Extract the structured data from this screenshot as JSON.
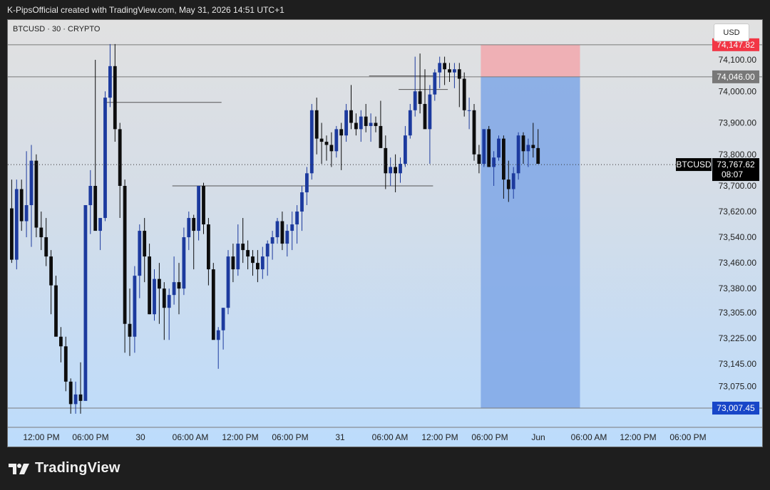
{
  "header": {
    "credit": "K-PipsOfficial created with TradingView.com, May 31, 2026 14:51 UTC+1"
  },
  "symbol_info": "BTCUSD · 30 · CRYPTO",
  "currency_button": "USD",
  "brand": "TradingView",
  "colors": {
    "bull": "#1c3a9e",
    "bear": "#0d0d0d",
    "stop_zone": "#f2a7ad",
    "target_zone": "#7fa7e6",
    "last_price": "#000000",
    "target_label": "#1846c8",
    "stop_label": "#f23645",
    "level_label": "#787878"
  },
  "chart_data": {
    "type": "candlestick",
    "symbol": "BTCUSD",
    "interval": "30",
    "y_ticks": [
      "74,100.00",
      "74,000.00",
      "73,900.00",
      "73,800.00",
      "73,700.00",
      "73,620.00",
      "73,540.00",
      "73,460.00",
      "73,380.00",
      "73,305.00",
      "73,225.00",
      "73,145.00",
      "73,075.00"
    ],
    "x_ticks": [
      "12:00 PM",
      "06:00 PM",
      "30",
      "06:00 AM",
      "12:00 PM",
      "06:00 PM",
      "31",
      "06:00 AM",
      "12:00 PM",
      "06:00 PM",
      "Jun",
      "06:00 AM",
      "12:00 PM",
      "06:00 PM"
    ],
    "price_labels": [
      {
        "name": "stop",
        "text": "74,147.82"
      },
      {
        "name": "entry",
        "text": "74,046.00"
      },
      {
        "name": "target",
        "text": "73,007.45"
      }
    ],
    "last_price": {
      "symbol": "BTCUSD",
      "value": "73,767.62",
      "countdown": "08:07"
    },
    "levels": [
      74147.82,
      74046.0,
      73007.45
    ],
    "annotation_lines": [
      {
        "from_bar": 19,
        "to_bar": 43,
        "price": 73965
      },
      {
        "from_bar": 33,
        "to_bar": 86,
        "price": 73700
      },
      {
        "from_bar": 73,
        "to_bar": 86,
        "price": 74049
      },
      {
        "from_bar": 79,
        "to_bar": 89,
        "price": 74006
      }
    ],
    "position_zone": {
      "from_bar": 96,
      "to_bar": 115,
      "stop": 74147.82,
      "entry": 74046.0,
      "target": 73007.45
    },
    "ohlc": [
      [
        73630,
        73720,
        73460,
        73470
      ],
      [
        73470,
        73720,
        73440,
        73690
      ],
      [
        73690,
        73720,
        73560,
        73590
      ],
      [
        73590,
        73810,
        73540,
        73640
      ],
      [
        73640,
        73830,
        73510,
        73780
      ],
      [
        73780,
        73800,
        73540,
        73570
      ],
      [
        73570,
        73620,
        73500,
        73540
      ],
      [
        73540,
        73600,
        73450,
        73480
      ],
      [
        73480,
        73500,
        73300,
        73390
      ],
      [
        73390,
        73420,
        73260,
        73230
      ],
      [
        73230,
        73260,
        73150,
        73200
      ],
      [
        73200,
        73230,
        73060,
        73090
      ],
      [
        73090,
        73100,
        72990,
        73020
      ],
      [
        73020,
        73090,
        72990,
        73050
      ],
      [
        73050,
        73150,
        72990,
        73030
      ],
      [
        73030,
        73640,
        73040,
        73640
      ],
      [
        73640,
        73750,
        73550,
        73700
      ],
      [
        73700,
        74100,
        73680,
        73560
      ],
      [
        73560,
        73600,
        73500,
        73600
      ],
      [
        73600,
        74000,
        73590,
        73980
      ],
      [
        73980,
        74150,
        73950,
        74080
      ],
      [
        74080,
        74150,
        73840,
        73880
      ],
      [
        73880,
        73900,
        73600,
        73700
      ],
      [
        73700,
        73720,
        73180,
        73270
      ],
      [
        73270,
        73380,
        73170,
        73230
      ],
      [
        73230,
        73450,
        73180,
        73420
      ],
      [
        73420,
        73580,
        73350,
        73560
      ],
      [
        73560,
        73600,
        73400,
        73480
      ],
      [
        73480,
        73520,
        73300,
        73300
      ],
      [
        73300,
        73440,
        73280,
        73410
      ],
      [
        73410,
        73460,
        73270,
        73380
      ],
      [
        73380,
        73400,
        73220,
        73320
      ],
      [
        73320,
        73380,
        73220,
        73360
      ],
      [
        73360,
        73480,
        73330,
        73400
      ],
      [
        73400,
        73460,
        73300,
        73380
      ],
      [
        73380,
        73570,
        73360,
        73540
      ],
      [
        73540,
        73620,
        73500,
        73600
      ],
      [
        73600,
        73610,
        73440,
        73560
      ],
      [
        73560,
        73700,
        73530,
        73700
      ],
      [
        73700,
        73710,
        73550,
        73580
      ],
      [
        73580,
        73600,
        73390,
        73440
      ],
      [
        73440,
        73460,
        73240,
        73220
      ],
      [
        73220,
        73260,
        73130,
        73250
      ],
      [
        73250,
        73320,
        73190,
        73320
      ],
      [
        73320,
        73500,
        73300,
        73480
      ],
      [
        73480,
        73520,
        73400,
        73440
      ],
      [
        73440,
        73580,
        73420,
        73520
      ],
      [
        73520,
        73600,
        73460,
        73500
      ],
      [
        73500,
        73530,
        73440,
        73480
      ],
      [
        73480,
        73500,
        73420,
        73460
      ],
      [
        73460,
        73500,
        73400,
        73440
      ],
      [
        73440,
        73510,
        73410,
        73480
      ],
      [
        73480,
        73530,
        73420,
        73520
      ],
      [
        73520,
        73560,
        73470,
        73540
      ],
      [
        73540,
        73600,
        73520,
        73590
      ],
      [
        73590,
        73620,
        73500,
        73520
      ],
      [
        73520,
        73580,
        73480,
        73560
      ],
      [
        73560,
        73620,
        73500,
        73580
      ],
      [
        73580,
        73640,
        73520,
        73620
      ],
      [
        73620,
        73700,
        73560,
        73680
      ],
      [
        73680,
        73760,
        73640,
        73740
      ],
      [
        73740,
        73960,
        73720,
        73940
      ],
      [
        73940,
        73980,
        73800,
        73850
      ],
      [
        73850,
        73900,
        73770,
        73840
      ],
      [
        73840,
        73860,
        73780,
        73830
      ],
      [
        73830,
        73870,
        73760,
        73810
      ],
      [
        73810,
        73890,
        73790,
        73880
      ],
      [
        73880,
        73900,
        73750,
        73860
      ],
      [
        73860,
        73960,
        73840,
        73940
      ],
      [
        73940,
        74020,
        73880,
        73900
      ],
      [
        73900,
        73930,
        73860,
        73880
      ],
      [
        73880,
        73940,
        73840,
        73920
      ],
      [
        73920,
        73960,
        73870,
        73890
      ],
      [
        73890,
        73930,
        73840,
        73900
      ],
      [
        73900,
        73920,
        73870,
        73890
      ],
      [
        73890,
        73970,
        73860,
        73820
      ],
      [
        73820,
        73860,
        73690,
        73740
      ],
      [
        73740,
        73790,
        73700,
        73760
      ],
      [
        73760,
        73800,
        73680,
        73740
      ],
      [
        73740,
        73790,
        73710,
        73770
      ],
      [
        73770,
        73890,
        73760,
        73860
      ],
      [
        73860,
        73960,
        73850,
        73940
      ],
      [
        73940,
        74110,
        73920,
        74000
      ],
      [
        74000,
        74120,
        73930,
        73960
      ],
      [
        73960,
        74070,
        73940,
        73880
      ],
      [
        73880,
        74020,
        73770,
        73990
      ],
      [
        73990,
        74070,
        73970,
        74060
      ],
      [
        74060,
        74110,
        74010,
        74090
      ],
      [
        74090,
        74110,
        74020,
        74070
      ],
      [
        74070,
        74090,
        74030,
        74060
      ],
      [
        74060,
        74090,
        74010,
        74070
      ],
      [
        74070,
        74090,
        73950,
        74040
      ],
      [
        74040,
        74060,
        73920,
        73940
      ],
      [
        73940,
        73980,
        73880,
        73940
      ],
      [
        73940,
        73960,
        73780,
        73800
      ],
      [
        73800,
        73830,
        73740,
        73770
      ],
      [
        73770,
        73880,
        73760,
        73880
      ],
      [
        73880,
        73890,
        73760,
        73760
      ],
      [
        73760,
        73810,
        73700,
        73790
      ],
      [
        73790,
        73860,
        73780,
        73850
      ],
      [
        73850,
        73860,
        73660,
        73720
      ],
      [
        73720,
        73780,
        73650,
        73690
      ],
      [
        73690,
        73760,
        73660,
        73740
      ],
      [
        73740,
        73870,
        73720,
        73860
      ],
      [
        73860,
        73870,
        73770,
        73810
      ],
      [
        73810,
        73850,
        73760,
        73830
      ],
      [
        73830,
        73900,
        73790,
        73820
      ],
      [
        73820,
        73880,
        73780,
        73770
      ]
    ]
  }
}
